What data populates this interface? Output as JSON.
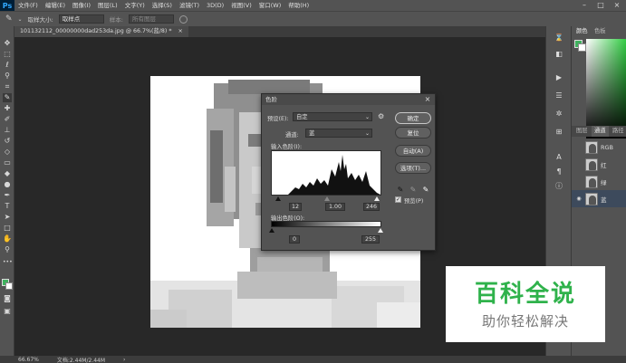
{
  "app": {
    "logo": "Ps"
  },
  "menu": [
    "文件(F)",
    "编辑(E)",
    "图像(I)",
    "图层(L)",
    "文字(Y)",
    "选择(S)",
    "滤镜(T)",
    "3D(D)",
    "视图(V)",
    "窗口(W)",
    "帮助(H)"
  ],
  "window_controls": {
    "minimize": "–",
    "maximize": "□",
    "close": "×"
  },
  "options_bar": {
    "size_label": "取样大小:",
    "size_value": "取样点",
    "sample_label": "样本:",
    "sample_value": "所有图层"
  },
  "document_tab": {
    "title": "101132112_00000000dad253da.jpg @ 66.7%(蓝/8) *",
    "close": "×"
  },
  "status_bar": {
    "zoom": "66.67%",
    "doc_info": "文档:2.44M/2.44M",
    "arrow": "›"
  },
  "right_panel": {
    "tabs_top": [
      "颜色",
      "色板"
    ],
    "tabs_bottom": [
      "图层",
      "通道",
      "路径"
    ],
    "channels": [
      {
        "name": "RGB"
      },
      {
        "name": "红"
      },
      {
        "name": "绿"
      },
      {
        "name": "蓝",
        "selected": true
      }
    ]
  },
  "levels_dialog": {
    "title": "色阶",
    "preset_label": "预设(E):",
    "preset_value": "自定",
    "channel_label": "通道:",
    "channel_value": "蓝",
    "input_label": "输入色阶(I):",
    "input_values": [
      "12",
      "1.00",
      "246"
    ],
    "output_label": "输出色阶(O):",
    "output_values": [
      "0",
      "255"
    ],
    "buttons": {
      "ok": "确定",
      "reset": "复位",
      "auto": "自动(A)",
      "options": "选项(T)..."
    },
    "preview_label": "预览(P)",
    "preview_checked": "✓",
    "close": "×"
  },
  "watermark": {
    "title": "百科全说",
    "subtitle": "助你轻松解决"
  },
  "colors": {
    "accent_green": "#3fb15e",
    "panel": "#535353",
    "canvas": "#282828"
  }
}
